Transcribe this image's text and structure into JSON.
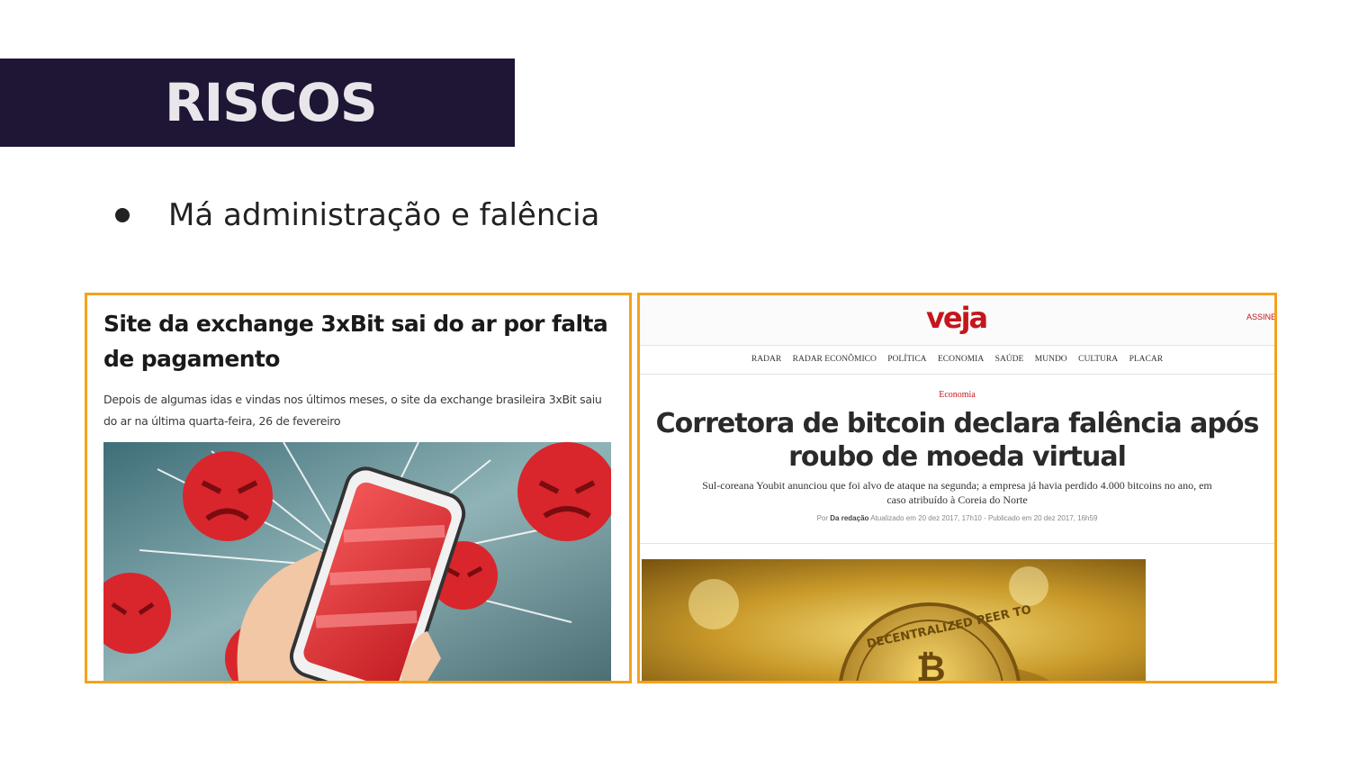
{
  "slide": {
    "title": "RISCOS",
    "bullet": "Má administração e falência",
    "colors": {
      "title_bar": "#1f1535",
      "card_border": "#f4a21c",
      "veja_red": "#c4161c"
    }
  },
  "left_article": {
    "headline": "Site da exchange 3xBit sai do ar por falta de pagamento",
    "summary": "Depois de algumas idas e vindas nos últimos meses, o site da exchange brasileira 3xBit saiu do ar na última quarta-feira, 26 de fevereiro",
    "image_icon": "angry-phone-illustration"
  },
  "right_article": {
    "logo": "veja",
    "subscribe": "ASSINE",
    "nav": [
      "RADAR",
      "RADAR ECONÔMICO",
      "POLÍTICA",
      "ECONOMIA",
      "SAÚDE",
      "MUNDO",
      "CULTURA",
      "PLACAR"
    ],
    "section": "Economia",
    "headline": "Corretora de bitcoin declara falência após roubo de moeda virtual",
    "dek": "Sul-coreana Youbit anunciou que foi alvo de ataque na segunda; a empresa já havia perdido 4.000 bitcoins no ano, em caso atribuído à Coreia do Norte",
    "byline_prefix": "Por",
    "byline_author": "Da redação",
    "byline_dates": "Atualizado em 20 dez 2017, 17h10 - Publicado em 20 dez 2017, 16h59",
    "image_icon": "bitcoin-coin-photo",
    "coin_text": "DECENTRALIZED PEER TO"
  }
}
